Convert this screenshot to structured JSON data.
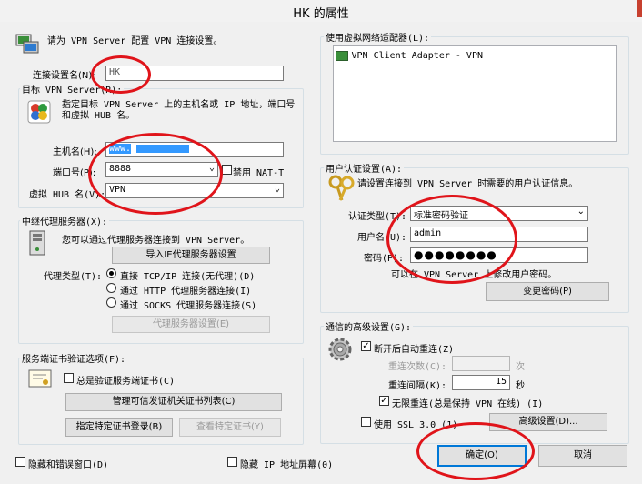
{
  "window": {
    "title": "HK 的属性",
    "close_glyph": "x"
  },
  "connection": {
    "header_text": "请为 VPN Server 配置 VPN 连接设置。",
    "name_label": "连接设置名(N):",
    "name_value": "HK"
  },
  "target": {
    "group_label": "目标 VPN Server(R):",
    "description": "指定目标 VPN Server 上的主机名或 IP 地址，端口号和虚拟 HUB 名。",
    "host_label": "主机名(H):",
    "host_value": "www.",
    "port_label": "端口号(P):",
    "port_value": "8888",
    "nat_t_label": "禁用 NAT-T",
    "hub_label": "虚拟 HUB 名(V):",
    "hub_value": "VPN"
  },
  "proxy": {
    "group_label": "中继代理服务器(X):",
    "description": "您可以通过代理服务器连接到 VPN Server。",
    "import_button": "导入IE代理服务器设置",
    "type_label": "代理类型(T):",
    "options": [
      "直接 TCP/IP 连接(无代理)(D)",
      "通过 HTTP 代理服务器连接(I)",
      "通过 SOCKS 代理服务器连接(S)"
    ],
    "selected_index": 0,
    "settings_button": "代理服务器设置(E)"
  },
  "cert": {
    "group_label": "服务端证书验证选项(F):",
    "always_verify_label": "总是验证服务端证书(C)",
    "manage_button": "管理可信发证机关证书列表(C)",
    "register_button": "指定特定证书登录(B)",
    "view_button": "查看特定证书(Y)"
  },
  "adapter": {
    "group_label": "使用虚拟网络适配器(L):",
    "items": [
      "VPN Client Adapter - VPN"
    ]
  },
  "auth": {
    "group_label": "用户认证设置(A):",
    "description": "请设置连接到 VPN Server 时需要的用户认证信息。",
    "type_label": "认证类型(T):",
    "type_value": "标准密码验证",
    "user_label": "用户名(U):",
    "user_value": "admin",
    "password_label": "密码(P):",
    "password_value": "●●●●●●●●",
    "note": "可以在 VPN Server 上修改用户密码。",
    "change_password_button": "变更密码(P)"
  },
  "advanced": {
    "group_label": "通信的高级设置(G):",
    "auto_reconnect_label": "断开后自动重连(Z)",
    "retry_count_label": "重连次数(C):",
    "retry_count_unit": "次",
    "retry_interval_label": "重连间隔(K):",
    "retry_interval_value": "15",
    "retry_interval_unit": "秒",
    "infinite_label": "无限重连(总是保持 VPN 在线) (I)",
    "ssl3_label": "使用 SSL 3.0 (1)",
    "advanced_button": "高级设置(D)..."
  },
  "bottom": {
    "hide_errors_label": "隐藏和错误窗口(D)",
    "hide_ip_label": "隐藏 IP 地址屏幕(0)",
    "ok_button": "确定(O)",
    "cancel_button": "取消"
  }
}
